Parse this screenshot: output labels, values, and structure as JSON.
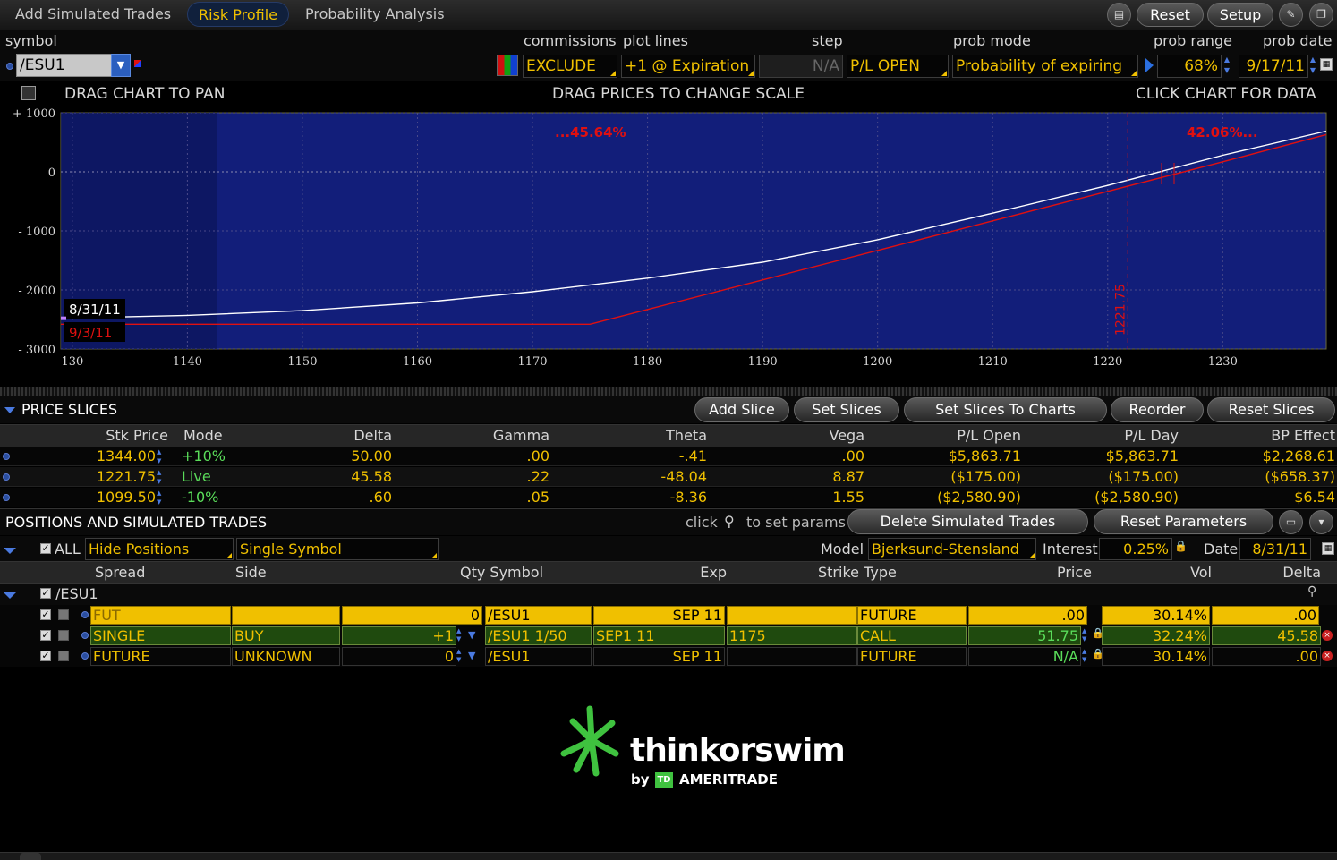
{
  "tabs": [
    {
      "label": "Add Simulated Trades",
      "active": false
    },
    {
      "label": "Risk Profile",
      "active": true
    },
    {
      "label": "Probability Analysis",
      "active": false
    }
  ],
  "toolbar": {
    "reset_label": "Reset",
    "setup_label": "Setup"
  },
  "controls": {
    "symbol_label": "symbol",
    "symbol_value": "/ESU1",
    "commissions_label": "commissions",
    "commissions_value": "EXCLUDE",
    "plot_lines_label": "plot lines",
    "plot_lines_value": "+1 @ Expiration",
    "step_label": "step",
    "step_value": "N/A",
    "prob_mode_label": "prob mode",
    "pl_value": "P/L OPEN",
    "prob_mode_value": "Probability of expiring",
    "prob_range_label": "prob range",
    "prob_range_value": "68%",
    "prob_date_label": "prob date",
    "prob_date_value": "9/17/11"
  },
  "chart_hints": {
    "left": "DRAG CHART TO PAN",
    "center": "DRAG PRICES TO CHANGE SCALE",
    "right": "CLICK CHART FOR DATA"
  },
  "chart_data": {
    "type": "line",
    "x_ticks": [
      "130",
      "1140",
      "1150",
      "1160",
      "1170",
      "1180",
      "1190",
      "1200",
      "1210",
      "1220",
      "1230"
    ],
    "y_ticks": [
      "+ 1000",
      "0",
      "- 1000",
      "- 2000",
      "- 3000"
    ],
    "xlim": [
      1129,
      1239
    ],
    "ylim": [
      -3000,
      1000
    ],
    "series": [
      {
        "name": "8/31/11",
        "color": "#ffffff",
        "x": [
          1129,
          1140,
          1150,
          1160,
          1170,
          1180,
          1190,
          1200,
          1210,
          1220,
          1230,
          1239
        ],
        "y": [
          -2480,
          -2430,
          -2350,
          -2220,
          -2030,
          -1800,
          -1530,
          -1150,
          -700,
          -230,
          280,
          690
        ]
      },
      {
        "name": "9/3/11",
        "color": "#e01010",
        "x": [
          1129,
          1140,
          1150,
          1160,
          1170,
          1175,
          1180,
          1190,
          1200,
          1210,
          1220,
          1230,
          1239
        ],
        "y": [
          -2580,
          -2580,
          -2580,
          -2580,
          -2580,
          -2580,
          -2330,
          -1830,
          -1330,
          -830,
          -330,
          170,
          630
        ]
      }
    ],
    "annotations": {
      "left_prob": "...45.64%",
      "right_prob": "42.06%...",
      "price_line": "1221.75",
      "price_line_x": 1221.75
    }
  },
  "slices": {
    "title": "PRICE SLICES",
    "buttons": [
      "Add Slice",
      "Set Slices",
      "Set Slices To Charts",
      "Reorder",
      "Reset Slices"
    ],
    "columns": [
      "Stk Price",
      "Mode",
      "Delta",
      "Gamma",
      "Theta",
      "Vega",
      "P/L Open",
      "P/L Day",
      "BP Effect"
    ],
    "rows": [
      [
        "1344.00",
        "+10%",
        "50.00",
        ".00",
        "-.41",
        ".00",
        "$5,863.71",
        "$5,863.71",
        "$2,268.61"
      ],
      [
        "1221.75",
        "Live",
        "45.58",
        ".22",
        "-48.04",
        "8.87",
        "($175.00)",
        "($175.00)",
        "($658.37)"
      ],
      [
        "1099.50",
        "-10%",
        ".60",
        ".05",
        "-8.36",
        "1.55",
        "($2,580.90)",
        "($2,580.90)",
        "$6.54"
      ]
    ]
  },
  "positions": {
    "title": "POSITIONS AND SIMULATED TRADES",
    "click_hint_pre": "click",
    "click_hint_post": "to set params",
    "delete_label": "Delete Simulated Trades",
    "reset_params_label": "Reset Parameters",
    "all_label": "ALL",
    "hide_positions": "Hide Positions",
    "single_symbol": "Single Symbol",
    "model_label": "Model",
    "model_value": "Bjerksund-Stensland",
    "interest_label": "Interest",
    "interest_value": "0.25%",
    "date_label": "Date",
    "date_value": "8/31/11",
    "columns": {
      "spread": "Spread",
      "side": "Side",
      "qty_symbol": "Qty Symbol",
      "exp": "Exp",
      "strike_type": "Strike Type",
      "price": "Price",
      "vol": "Vol",
      "delta": "Delta"
    },
    "group": "/ESU1",
    "rows": [
      {
        "spread": "FUT",
        "side": "",
        "qty": "0",
        "symbol": "/ESU1",
        "exp": "SEP 11",
        "strike": "",
        "type": "FUTURE",
        "price": ".00",
        "vol": "30.14%",
        "delta": ".00"
      },
      {
        "spread": "SINGLE",
        "side": "BUY",
        "qty": "+1",
        "symbol": "/ESU1 1/50",
        "exp": "SEP1 11",
        "strike": "1175",
        "type": "CALL",
        "price": "51.75",
        "vol": "32.24%",
        "delta": "45.58"
      },
      {
        "spread": "FUTURE",
        "side": "UNKNOWN",
        "qty": "0",
        "symbol": "/ESU1",
        "exp": "SEP 11",
        "strike": "",
        "type": "FUTURE",
        "price": "N/A",
        "vol": "30.14%",
        "delta": ".00"
      }
    ]
  },
  "logo": {
    "name": "thinkorswim",
    "by": "by",
    "td": "TD",
    "brand": "AMERITRADE"
  },
  "colors": {
    "accent": "#f0c000",
    "chart_bg": "#121e7a",
    "positive": "#5adc5a"
  }
}
